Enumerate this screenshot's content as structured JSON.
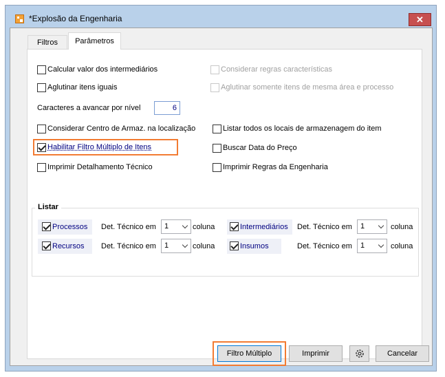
{
  "window": {
    "title": "*Explosão da Engenharia",
    "close_label": "✕"
  },
  "tabs": [
    {
      "label": "Filtros"
    },
    {
      "label": "Parâmetros"
    }
  ],
  "options": {
    "calc_intermediarios": {
      "label": "Calcular valor dos intermediários",
      "checked": false
    },
    "considerar_regras": {
      "label": "Considerar regras características",
      "checked": false,
      "disabled": true
    },
    "aglutinar_itens": {
      "label": "Aglutinar itens iguais",
      "checked": false
    },
    "aglutinar_area": {
      "label": "Aglutinar somente itens de mesma área e processo",
      "checked": false,
      "disabled": true
    },
    "caracteres_label": "Caracteres a avancar por nível",
    "caracteres_value": "6",
    "considerar_centro": {
      "label": "Considerar Centro de Armaz. na localização",
      "checked": false
    },
    "listar_locais": {
      "label": "Listar todos os locais de armazenagem do item",
      "checked": false
    },
    "habilitar_filtro": {
      "label": "Habilitar Filtro Múltiplo de Itens",
      "checked": true
    },
    "buscar_data": {
      "label": "Buscar Data do Preço",
      "checked": false
    },
    "imprimir_detalhamento": {
      "label": "Imprimir Detalhamento Técnico",
      "checked": false
    },
    "imprimir_regras": {
      "label": "Imprimir Regras da Engenharia",
      "checked": false
    }
  },
  "listar": {
    "title": "Listar",
    "det_label": "Det. Técnico em",
    "coluna_label": "coluna",
    "items": [
      {
        "label": "Processos",
        "checked": true,
        "value": "1"
      },
      {
        "label": "Intermediários",
        "checked": true,
        "value": "1"
      },
      {
        "label": "Recursos",
        "checked": true,
        "value": "1"
      },
      {
        "label": "Insumos",
        "checked": true,
        "value": "1"
      }
    ]
  },
  "buttons": {
    "filtro_multiplo": "Filtro Múltiplo",
    "imprimir": "Imprimir",
    "settings_icon": "gear-icon",
    "cancelar": "Cancelar"
  },
  "colors": {
    "highlight": "#f27b32",
    "link": "#000080",
    "titlebar": "#b9d1ea",
    "close": "#c75050"
  }
}
